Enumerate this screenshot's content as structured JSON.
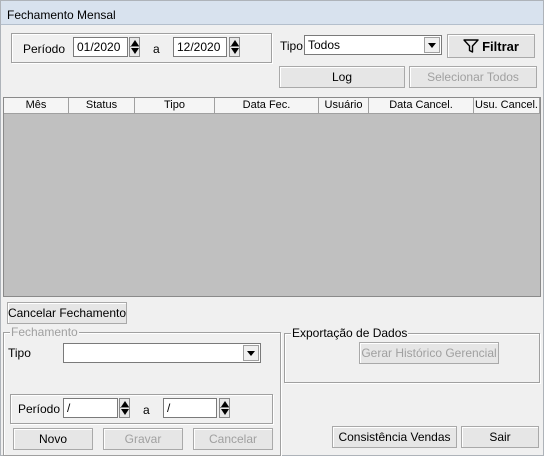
{
  "window": {
    "title": "Fechamento Mensal"
  },
  "filter": {
    "periodo_label": "Período",
    "periodo_from": "01/2020",
    "a_label": "a",
    "periodo_to": "12/2020",
    "tipo_label": "Tipo",
    "tipo_value": "Todos",
    "filtrar_label": "Filtrar",
    "log_label": "Log",
    "selecionar_todos_label": "Selecionar Todos"
  },
  "grid": {
    "columns": [
      "Mês",
      "Status",
      "Tipo",
      "Data Fec.",
      "Usuário",
      "Data Cancel.",
      "Usu. Cancel."
    ]
  },
  "actions": {
    "cancelar_fechamento_label": "Cancelar Fechamento"
  },
  "fechamento": {
    "group_title": "Fechamento",
    "tipo_label": "Tipo",
    "tipo_value": "",
    "periodo_label": "Período",
    "periodo_from": "/",
    "a_label": "a",
    "periodo_to": "/",
    "novo_label": "Novo",
    "gravar_label": "Gravar",
    "cancelar_label": "Cancelar"
  },
  "exportacao": {
    "group_title": "Exportação de Dados",
    "gerar_label": "Gerar Histórico Gerencial"
  },
  "footer": {
    "consistencia_label": "Consistência Vendas",
    "sair_label": "Sair"
  }
}
